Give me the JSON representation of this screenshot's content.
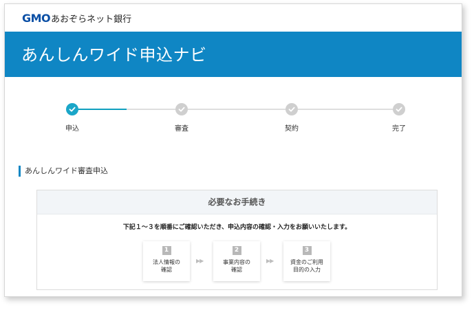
{
  "header": {
    "logo_gmo": "GMO",
    "logo_bank": "あおぞらネット銀行"
  },
  "title": "あんしんワイド申込ナビ",
  "stepper": {
    "steps": [
      {
        "label": "申込",
        "state": "done"
      },
      {
        "label": "審査",
        "state": "pending"
      },
      {
        "label": "契約",
        "state": "pending"
      },
      {
        "label": "完了",
        "state": "pending"
      }
    ],
    "colors": {
      "active": "#1ba6c8",
      "inactive": "#cfcfcf"
    }
  },
  "section": {
    "heading": "あんしんワイド審査申込"
  },
  "procedures": {
    "header": "必要なお手続き",
    "intro": "下記１～３を順番にご確認いただき、申込内容の確認・入力をお願いいたします。",
    "cards": [
      {
        "num": "1",
        "line1": "法人情報の",
        "line2": "確認"
      },
      {
        "num": "2",
        "line1": "事業内容の",
        "line2": "確認"
      },
      {
        "num": "3",
        "line1": "資金のご利用",
        "line2": "目的の入力"
      }
    ],
    "arrow": "▶▶"
  },
  "colors": {
    "brand_blue": "#0f86c4",
    "logo_blue": "#0b4fa5"
  },
  "icons": {
    "step_check": "check-icon"
  }
}
